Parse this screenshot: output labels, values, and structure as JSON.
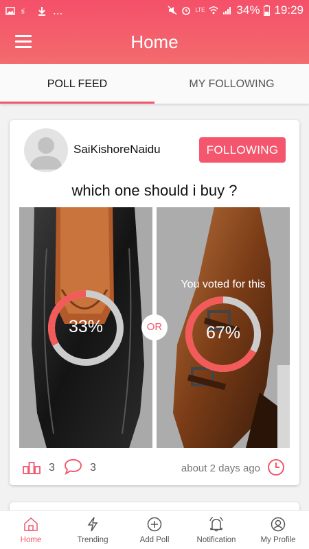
{
  "status_bar": {
    "battery": "34%",
    "time": "19:29",
    "network": "LTE",
    "ellipsis": "..."
  },
  "header": {
    "title": "Home"
  },
  "tabs": [
    {
      "label": "POLL FEED",
      "active": true
    },
    {
      "label": "MY FOLLOWING",
      "active": false
    }
  ],
  "post": {
    "username": "SaiKishoreNaidu",
    "follow_label": "FOLLOWING",
    "question": "which one should i buy ?",
    "options": [
      {
        "percent": "33%",
        "value": 33,
        "voted": false
      },
      {
        "percent": "67%",
        "value": 67,
        "voted": true,
        "voted_label": "You voted for this"
      }
    ],
    "or_label": "OR",
    "votes_count": "3",
    "comments_count": "3",
    "time_ago": "about 2 days ago"
  },
  "bottom_nav": [
    {
      "label": "Home",
      "icon": "home-icon",
      "active": true
    },
    {
      "label": "Trending",
      "icon": "trending-icon",
      "active": false
    },
    {
      "label": "Add Poll",
      "icon": "add-poll-icon",
      "active": false
    },
    {
      "label": "Notification",
      "icon": "notification-icon",
      "active": false
    },
    {
      "label": "My Profile",
      "icon": "profile-icon",
      "active": false
    }
  ],
  "colors": {
    "accent": "#f2566b",
    "header_top": "#f4506a",
    "header_bottom": "#f36b6d"
  }
}
